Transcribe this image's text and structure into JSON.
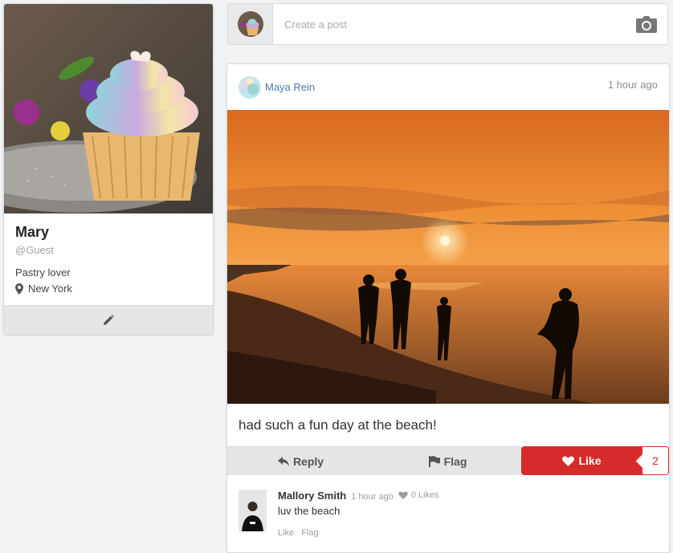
{
  "profile": {
    "name": "Mary",
    "handle": "@Guest",
    "bio": "Pastry lover",
    "location": "New York",
    "edit_icon": "pencil-icon",
    "location_icon": "map-marker-icon"
  },
  "composer": {
    "placeholder": "Create a post",
    "camera_icon": "camera-icon"
  },
  "post": {
    "author": "Maya Rein",
    "time": "1 hour ago",
    "text": "had such a fun day at the beach!",
    "actions": {
      "reply": "Reply",
      "flag": "Flag",
      "like": "Like",
      "like_count": "2"
    }
  },
  "comment": {
    "author": "Mallory Smith",
    "time": "1 hour ago",
    "likes": "0 Likes",
    "text": "luv the beach",
    "like_label": "Like",
    "flag_label": "Flag"
  },
  "colors": {
    "like_red": "#d52b2b",
    "link_blue": "#4a77b4",
    "page_bg": "#f1f2f4"
  }
}
